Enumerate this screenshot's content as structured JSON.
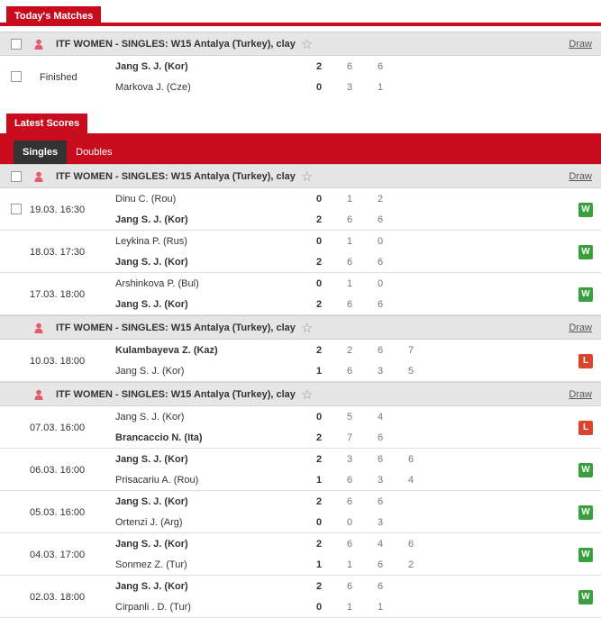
{
  "today": {
    "tab_label": "Today's Matches",
    "league": {
      "title": "ITF WOMEN - SINGLES: W15 Antalya (Turkey), clay",
      "draw": "Draw"
    },
    "match": {
      "status": "Finished",
      "p1": {
        "name": "Jang S. J. (Kor)",
        "total": "2",
        "sets": [
          "6",
          "6"
        ],
        "win": true
      },
      "p2": {
        "name": "Markova J. (Cze)",
        "total": "0",
        "sets": [
          "3",
          "1"
        ],
        "win": false
      }
    }
  },
  "latest": {
    "tab_label": "Latest Scores",
    "subtabs": [
      "Singles",
      "Doubles"
    ],
    "groups": [
      {
        "title": "ITF WOMEN - SINGLES: W15 Antalya (Turkey), clay",
        "draw": "Draw",
        "checkbox": true,
        "matches": [
          {
            "date": "19.03. 16:30",
            "checkbox": true,
            "result": "W",
            "p1": {
              "name": "Dinu C. (Rou)",
              "total": "0",
              "sets": [
                "1",
                "2"
              ],
              "win": false
            },
            "p2": {
              "name": "Jang S. J. (Kor)",
              "total": "2",
              "sets": [
                "6",
                "6"
              ],
              "win": true
            }
          },
          {
            "date": "18.03. 17:30",
            "result": "W",
            "p1": {
              "name": "Leykina P. (Rus)",
              "total": "0",
              "sets": [
                "1",
                "0"
              ],
              "win": false
            },
            "p2": {
              "name": "Jang S. J. (Kor)",
              "total": "2",
              "sets": [
                "6",
                "6"
              ],
              "win": true
            }
          },
          {
            "date": "17.03. 18:00",
            "result": "W",
            "p1": {
              "name": "Arshinkova P. (Bul)",
              "total": "0",
              "sets": [
                "1",
                "0"
              ],
              "win": false
            },
            "p2": {
              "name": "Jang S. J. (Kor)",
              "total": "2",
              "sets": [
                "6",
                "6"
              ],
              "win": true
            }
          }
        ]
      },
      {
        "title": "ITF WOMEN - SINGLES: W15 Antalya (Turkey), clay",
        "draw": "Draw",
        "checkbox": false,
        "matches": [
          {
            "date": "10.03. 18:00",
            "result": "L",
            "p1": {
              "name": "Kulambayeva Z. (Kaz)",
              "total": "2",
              "sets": [
                "2",
                "6",
                "7"
              ],
              "win": true
            },
            "p2": {
              "name": "Jang S. J. (Kor)",
              "total": "1",
              "sets": [
                "6",
                "3",
                "5"
              ],
              "win": false
            }
          }
        ]
      },
      {
        "title": "ITF WOMEN - SINGLES: W15 Antalya (Turkey), clay",
        "draw": "Draw",
        "checkbox": false,
        "matches": [
          {
            "date": "07.03. 16:00",
            "result": "L",
            "p1": {
              "name": "Jang S. J. (Kor)",
              "total": "0",
              "sets": [
                "5",
                "4"
              ],
              "win": false
            },
            "p2": {
              "name": "Brancaccio N. (Ita)",
              "total": "2",
              "sets": [
                "7",
                "6"
              ],
              "win": true
            }
          },
          {
            "date": "06.03. 16:00",
            "result": "W",
            "p1": {
              "name": "Jang S. J. (Kor)",
              "total": "2",
              "sets": [
                "3",
                "6",
                "6"
              ],
              "win": true
            },
            "p2": {
              "name": "Prisacariu A. (Rou)",
              "total": "1",
              "sets": [
                "6",
                "3",
                "4"
              ],
              "win": false
            }
          },
          {
            "date": "05.03. 16:00",
            "result": "W",
            "p1": {
              "name": "Jang S. J. (Kor)",
              "total": "2",
              "sets": [
                "6",
                "6"
              ],
              "win": true
            },
            "p2": {
              "name": "Ortenzi J. (Arg)",
              "total": "0",
              "sets": [
                "0",
                "3"
              ],
              "win": false
            }
          },
          {
            "date": "04.03. 17:00",
            "result": "W",
            "p1": {
              "name": "Jang S. J. (Kor)",
              "total": "2",
              "sets": [
                "6",
                "4",
                "6"
              ],
              "win": true
            },
            "p2": {
              "name": "Sonmez Z. (Tur)",
              "total": "1",
              "sets": [
                "1",
                "6",
                "2"
              ],
              "win": false
            }
          },
          {
            "date": "02.03. 18:00",
            "result": "W",
            "p1": {
              "name": "Jang S. J. (Kor)",
              "total": "2",
              "sets": [
                "6",
                "6"
              ],
              "win": true
            },
            "p2": {
              "name": "Cirpanli . D. (Tur)",
              "total": "0",
              "sets": [
                "1",
                "1"
              ],
              "win": false
            }
          }
        ]
      }
    ]
  },
  "icons": {
    "favorite": "star-outline-icon",
    "category": "woman-person-icon"
  },
  "colors": {
    "brand_red": "#c80c1e",
    "win": "#3aa03e",
    "loss": "#d9442f",
    "league_bg": "#e5e5e5"
  }
}
